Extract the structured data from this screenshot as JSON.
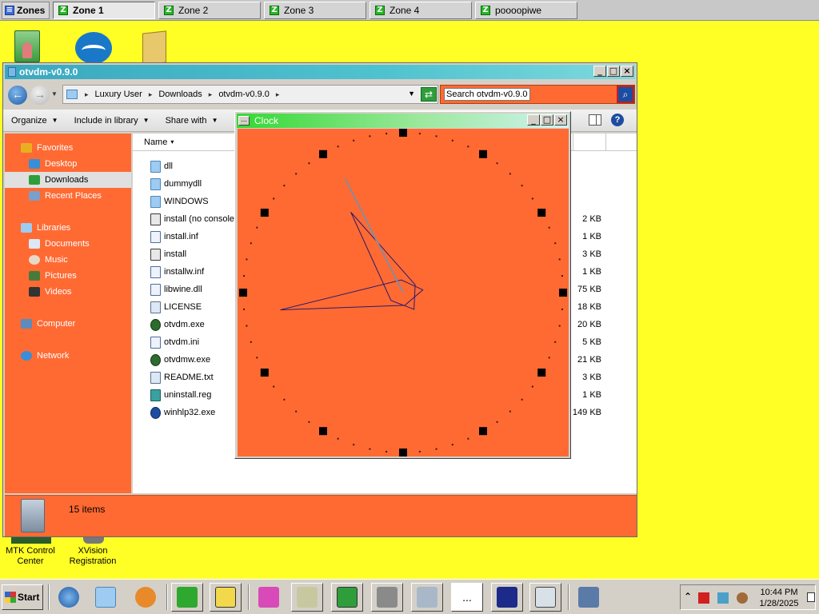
{
  "zonebar": {
    "zones_label": "Zones",
    "tabs": [
      {
        "label": "Zone 1",
        "active": true
      },
      {
        "label": "Zone 2",
        "active": false
      },
      {
        "label": "Zone 3",
        "active": false
      },
      {
        "label": "Zone 4",
        "active": false
      },
      {
        "label": "poooopiwe",
        "active": false
      }
    ]
  },
  "desktop": {
    "icons": [
      {
        "label": "MTK Control Center",
        "icon": "mtk-icon"
      },
      {
        "label": "XVision Registration",
        "icon": "xvision-icon"
      }
    ]
  },
  "explorer": {
    "title": "otvdm-v0.9.0",
    "breadcrumb": [
      "Luxury User",
      "Downloads",
      "otvdm-v0.9.0"
    ],
    "search_placeholder": "Search otvdm-v0.9.0",
    "commands": [
      "Organize",
      "Include in library",
      "Share with"
    ],
    "nav": {
      "favorites": "Favorites",
      "desktop": "Desktop",
      "downloads": "Downloads",
      "recent": "Recent Places",
      "libraries": "Libraries",
      "documents": "Documents",
      "music": "Music",
      "pictures": "Pictures",
      "videos": "Videos",
      "computer": "Computer",
      "network": "Network"
    },
    "column_name": "Name",
    "files": [
      {
        "name": "dll",
        "size": "",
        "type": "folder"
      },
      {
        "name": "dummydll",
        "size": "",
        "type": "folder"
      },
      {
        "name": "WINDOWS",
        "size": "",
        "type": "folder"
      },
      {
        "name": "install (no console)",
        "size": "2 KB",
        "type": "setup"
      },
      {
        "name": "install.inf",
        "size": "1 KB",
        "type": "cfg"
      },
      {
        "name": "install",
        "size": "3 KB",
        "type": "setup"
      },
      {
        "name": "installw.inf",
        "size": "1 KB",
        "type": "cfg"
      },
      {
        "name": "libwine.dll",
        "size": "75 KB",
        "type": "cfg"
      },
      {
        "name": "LICENSE",
        "size": "18 KB",
        "type": "doc"
      },
      {
        "name": "otvdm.exe",
        "size": "20 KB",
        "type": "exe"
      },
      {
        "name": "otvdm.ini",
        "size": "5 KB",
        "type": "cfg"
      },
      {
        "name": "otvdmw.exe",
        "size": "21 KB",
        "type": "exe"
      },
      {
        "name": "README.txt",
        "size": "3 KB",
        "type": "doc"
      },
      {
        "name": "uninstall.reg",
        "size": "1 KB",
        "type": "reg"
      },
      {
        "name": "winhlp32.exe",
        "size": "149 KB",
        "type": "help"
      }
    ],
    "status": "15 items"
  },
  "clock": {
    "title": "Clock",
    "system_menu_glyph": "..."
  },
  "taskbar": {
    "start_label": "Start",
    "time": "10:44 PM",
    "date": "1/28/2025",
    "dots_label": "...",
    "colors": {
      "desktop_bg": "#ffff26",
      "accent": "#ff6a33"
    }
  }
}
